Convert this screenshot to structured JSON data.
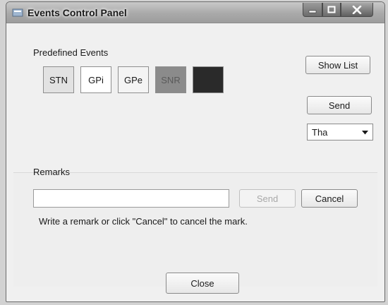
{
  "window": {
    "title": "Events Control Panel"
  },
  "events": {
    "group_label": "Predefined Events",
    "buttons": [
      {
        "label": "STN",
        "bg": "#e2e2e2"
      },
      {
        "label": "GPi",
        "bg": "#ffffff"
      },
      {
        "label": "GPe",
        "bg": "#f4f4f4"
      },
      {
        "label": "SNR",
        "bg": "#8b8b8b"
      },
      {
        "label": "",
        "bg": "#2a2a2a"
      }
    ],
    "show_list_label": "Show List",
    "send_label": "Send",
    "select_value": "Tha"
  },
  "remarks": {
    "group_label": "Remarks",
    "input_value": "",
    "send_label": "Send",
    "cancel_label": "Cancel",
    "hint": "Write a remark or click \"Cancel\" to cancel the mark."
  },
  "footer": {
    "close_label": "Close"
  },
  "icons": {
    "app": "app-icon",
    "minimize": "minimize-icon",
    "maximize": "maximize-icon",
    "close": "close-icon",
    "dropdown": "chevron-down-icon"
  }
}
